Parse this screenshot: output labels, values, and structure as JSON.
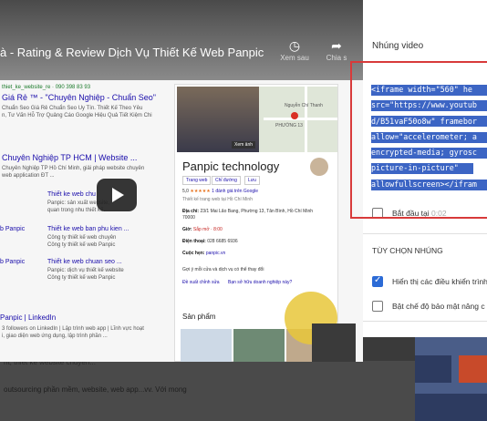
{
  "video": {
    "title": "à - Rating & Review Dịch Vụ Thiết Kế Web Panpic",
    "watch_later_label": "Xem sau",
    "share_label": "Chia s",
    "watch_later_icon": "clock-icon",
    "share_icon": "share-icon",
    "play_icon": "play-icon"
  },
  "serp": {
    "lines": [
      "thiet_ke_website_re · 090 398 83 93",
      "Giá Rẻ ™ - \"Chuyên Nghiệp - Chuẩn Seo\"",
      "Chuẩn Seo Giá Rẻ Chuẩn Seo Uy Tín. Thiết Kế Theo Yêu",
      "n, Tư Vấn Hỗ Trợ Quảng Cáo Google Hiệu Quả Tiết Kiệm Chi",
      "Chuyên Nghiệp TP HCM | Website ...",
      "Chuyên Nghiệp TP Hồ Chí Minh, giải pháp website chuyên",
      "web application ĐT ...",
      "Thiết ke web chu",
      "Panpic: sản xuất website,",
      "quan trong nhu thiết kế.",
      "Thiết ke web ban phu kien ...",
      "Công ty thiết kế web chuyên",
      "Công ty thiết kế web Panpic",
      "Thiết ke web chuan seo ...",
      "Panpic: dịch vụ thiết kế website",
      "Công ty thiết kế web Panpic",
      "Panpic | LinkedIn",
      "3 followers on LinkedIn | Lập trình web app | Lĩnh vực hoạt",
      "i, giao diện web ứng dụng, lập trình phần ..."
    ],
    "link_fragments": [
      "b Panpic",
      "b Panpic",
      "n",
      "n"
    ]
  },
  "knowledge_panel": {
    "map_label": "Xem ảnh",
    "map_place": "Nguyễn Chí Thanh",
    "map_ward": "PHƯỜNG 13",
    "title": "Panpic technology",
    "buttons": [
      "Trang web",
      "Chỉ đường",
      "Lưu"
    ],
    "rating_text": "5,0",
    "rating_stars": "★★★★★",
    "rating_note": "1 đánh giá trên Google",
    "category": "Thiết kế trang web tại Hồ Chí Minh",
    "address_label": "Địa chỉ:",
    "address": "23/1 Mai Lão Bang, Phường 13, Tân Bình, Hồ Chí Minh",
    "postcode": "70000",
    "hours_label": "Giờ:",
    "hours": "Sắp mở · 8:00",
    "phone_label": "Điện thoại:",
    "phone": "028 6685 6936",
    "order_label": "Cuộc hẹn:",
    "order_value": "panpic.vn",
    "suggest": "Gợi ý mỗi cửa và dịch vụ có thể thay đổi",
    "links": [
      "Đề xuất chỉnh sửa",
      "Bạn sở hữu doanh nghiệp này?"
    ],
    "products_label": "Sản phẩm"
  },
  "below": {
    "text1": "ht, thiết kế website chuyên...",
    "text2": "outsourcing phần mềm, website, web app...vv. Với mong"
  },
  "embed": {
    "title": "Nhúng video",
    "code_lines": [
      "<iframe width=\"560\" he",
      "src=\"https://www.youtub",
      "d/B51vaF50o8w\" framebor",
      "allow=\"accelerometer; a",
      "encrypted-media; gyrosc",
      "picture-in-picture\"",
      "allowfullscreen></ifram"
    ],
    "start_at_label": "Bắt đầu tại",
    "start_at_time": "0:02",
    "start_at_checked": false,
    "options_heading": "TÙY CHỌN NHÚNG",
    "options": [
      {
        "label": "Hiển thị các điều khiển trình",
        "checked": true
      },
      {
        "label": "Bật chế độ bảo mật nâng c",
        "checked": false
      }
    ],
    "accent_color": "#2c6bd6",
    "highlight_color": "#3c65c4",
    "frame_color": "#d83a3a"
  }
}
